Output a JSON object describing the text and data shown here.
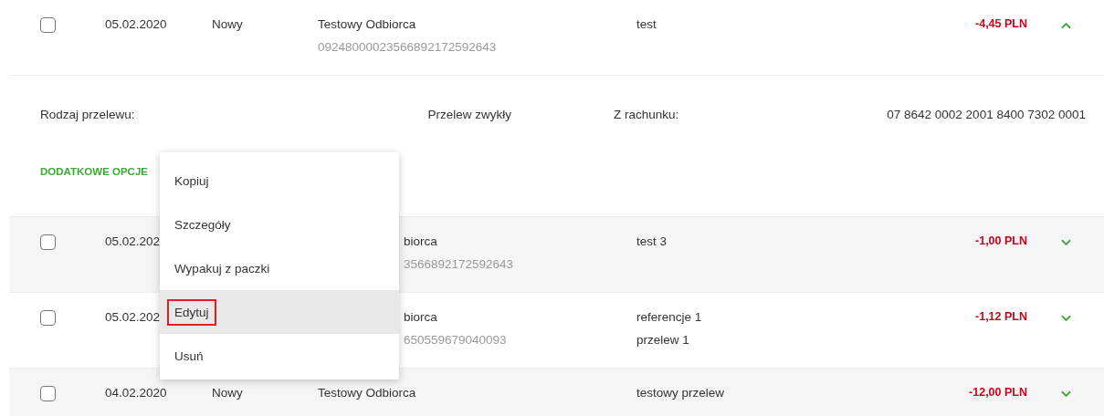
{
  "rows": [
    {
      "checked": false,
      "date": "05.02.2020",
      "status": "Nowy",
      "recipient": "Testowy Odbiorca",
      "account": "09248000023566892172592643",
      "title": [
        "test"
      ],
      "amount": "-4,45 PLN",
      "expanded": true,
      "details": {
        "fields": [
          {
            "label": "Rodzaj przelewu:",
            "value": "Przelew zwykły"
          },
          {
            "label": "Z rachunku:",
            "value": "07 8642 0002 2001 8400 7302 0001"
          }
        ],
        "options_label": "DODATKOWE OPCJE"
      }
    },
    {
      "checked": false,
      "date": "05.02.202",
      "covered": true,
      "recipient": "biorca",
      "account": "3566892172592643",
      "title": [
        "test 3"
      ],
      "amount": "-1,00 PLN",
      "expanded": false
    },
    {
      "checked": false,
      "date": "05.02.202",
      "covered": true,
      "recipient": "biorca",
      "account": "650559679040093",
      "title": [
        "referencje 1",
        "przelew 1"
      ],
      "amount": "-1,12 PLN",
      "expanded": false
    },
    {
      "checked": false,
      "date": "04.02.2020",
      "status": "Nowy",
      "recipient": "Testowy Odbiorca",
      "title": [
        "testowy przelew"
      ],
      "amount": "-12,00 PLN",
      "expanded": false
    }
  ],
  "menu": {
    "items": [
      {
        "label": "Kopiuj",
        "selected": false,
        "marked": false
      },
      {
        "label": "Szczegóły",
        "selected": false,
        "marked": false
      },
      {
        "label": "Wypakuj z paczki",
        "selected": false,
        "marked": false
      },
      {
        "label": "Edytuj",
        "selected": true,
        "marked": true
      },
      {
        "label": "Usuń",
        "selected": false,
        "marked": false
      }
    ]
  }
}
